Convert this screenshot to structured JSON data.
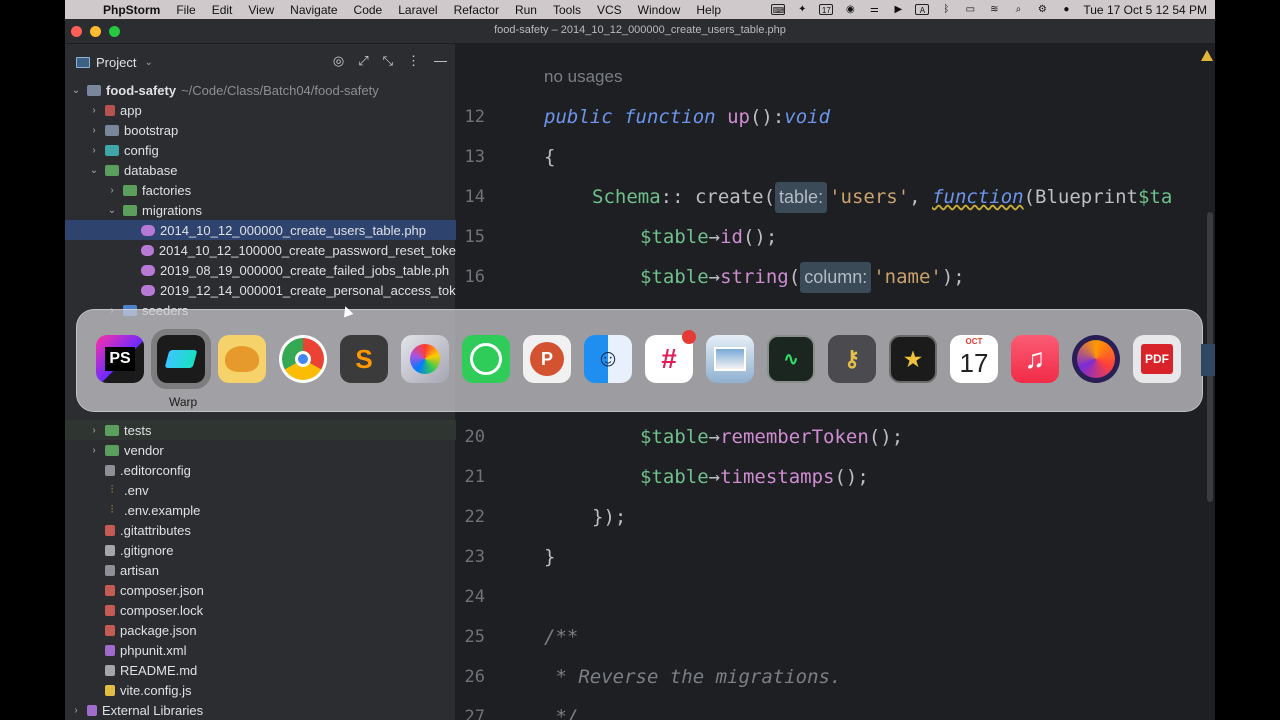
{
  "menubar": {
    "app": "PhpStorm",
    "items": [
      "File",
      "Edit",
      "View",
      "Navigate",
      "Code",
      "Laravel",
      "Refactor",
      "Run",
      "Tools",
      "VCS",
      "Window",
      "Help"
    ],
    "calendar_icon_day": "17",
    "input_source": "A",
    "clock": "Tue 17 Oct  5 12 54 PM"
  },
  "window": {
    "title": "food-safety – 2014_10_12_000000_create_users_table.php"
  },
  "project": {
    "header": "Project",
    "rows": [
      {
        "label": "food-safety",
        "path": "~/Code/Class/Batch04/food-safety"
      },
      {
        "label": "app"
      },
      {
        "label": "bootstrap"
      },
      {
        "label": "config"
      },
      {
        "label": "database"
      },
      {
        "label": "factories"
      },
      {
        "label": "migrations"
      },
      {
        "label": "2014_10_12_000000_create_users_table.php"
      },
      {
        "label": "2014_10_12_100000_create_password_reset_toke"
      },
      {
        "label": "2019_08_19_000000_create_failed_jobs_table.ph"
      },
      {
        "label": "2019_12_14_000001_create_personal_access_tok"
      },
      {
        "label": "seeders"
      },
      {
        "label": "tests"
      },
      {
        "label": "vendor"
      },
      {
        "label": ".editorconfig"
      },
      {
        "label": ".env"
      },
      {
        "label": ".env.example"
      },
      {
        "label": ".gitattributes"
      },
      {
        "label": ".gitignore"
      },
      {
        "label": "artisan"
      },
      {
        "label": "composer.json"
      },
      {
        "label": "composer.lock"
      },
      {
        "label": "package.json"
      },
      {
        "label": "phpunit.xml"
      },
      {
        "label": "README.md"
      },
      {
        "label": "vite.config.js"
      },
      {
        "label": "External Libraries"
      }
    ]
  },
  "editor": {
    "usages": "no usages",
    "lines": [
      {
        "n": "12",
        "parts": [
          "public",
          "function",
          "up",
          "(): ",
          "void"
        ]
      },
      {
        "n": "13",
        "parts": [
          "{"
        ]
      },
      {
        "n": "14",
        "parts": [
          "Schema",
          " :: create(",
          "table:",
          "'users'",
          ", ",
          "function",
          " (Blueprint ",
          "$ta"
        ]
      },
      {
        "n": "15",
        "parts": [
          "$table",
          "→",
          "id",
          "();"
        ]
      },
      {
        "n": "16",
        "parts": [
          "$table",
          "→",
          "string",
          "(",
          "column:",
          "'name'",
          ");"
        ]
      },
      {
        "n": "20",
        "parts": [
          "$table",
          "→",
          "rememberToken",
          "();"
        ]
      },
      {
        "n": "21",
        "parts": [
          "$table",
          "→",
          "timestamps",
          "();"
        ]
      },
      {
        "n": "22",
        "parts": [
          "});"
        ]
      },
      {
        "n": "23",
        "parts": [
          "}"
        ]
      },
      {
        "n": "24",
        "parts": []
      },
      {
        "n": "25",
        "parts": [
          "/**"
        ]
      },
      {
        "n": "26",
        "parts": [
          " * Reverse the migrations."
        ]
      },
      {
        "n": "27",
        "parts": [
          " */"
        ]
      }
    ]
  },
  "dock": {
    "tooltip": "Warp",
    "apps": [
      {
        "name": "PhpStorm",
        "glyph": "PS",
        "color": "#2b1f5c"
      },
      {
        "name": "Warp",
        "glyph": "",
        "color": "#1b1b1b"
      },
      {
        "name": "TablePlus",
        "glyph": "",
        "color": "#f3c54a"
      },
      {
        "name": "Chrome",
        "glyph": "",
        "color": "#ffffff"
      },
      {
        "name": "Sublime Text",
        "glyph": "S",
        "color": "#3b3b3b"
      },
      {
        "name": "Final Cut",
        "glyph": "",
        "color": "#d7d7dc"
      },
      {
        "name": "WhatsApp",
        "glyph": "",
        "color": "#2fcc5a"
      },
      {
        "name": "PowerPoint",
        "glyph": "P",
        "color": "#f1f1f1"
      },
      {
        "name": "Finder",
        "glyph": "",
        "color": "#3a9cf0"
      },
      {
        "name": "Slack",
        "glyph": "#",
        "color": "#ffffff"
      },
      {
        "name": "Preview",
        "glyph": "",
        "color": "#c9d6e4"
      },
      {
        "name": "Activity Monitor",
        "glyph": "",
        "color": "#1c2620"
      },
      {
        "name": "Keychain",
        "glyph": "",
        "color": "#4b4b4f"
      },
      {
        "name": "Script",
        "glyph": "",
        "color": "#1b1b1b"
      },
      {
        "name": "Calendar",
        "glyph": "17",
        "month": "OCT",
        "color": "#ffffff"
      },
      {
        "name": "Music",
        "glyph": "♫",
        "color": "#f43b55"
      },
      {
        "name": "Firefox",
        "glyph": "",
        "color": "#3b2a7a"
      },
      {
        "name": "PDF",
        "glyph": "PDF",
        "color": "#e8e8ea"
      }
    ]
  },
  "colors": {
    "accent": "#2e436e",
    "editor_bg": "#1e1f22",
    "panel_bg": "#2b2d30"
  }
}
